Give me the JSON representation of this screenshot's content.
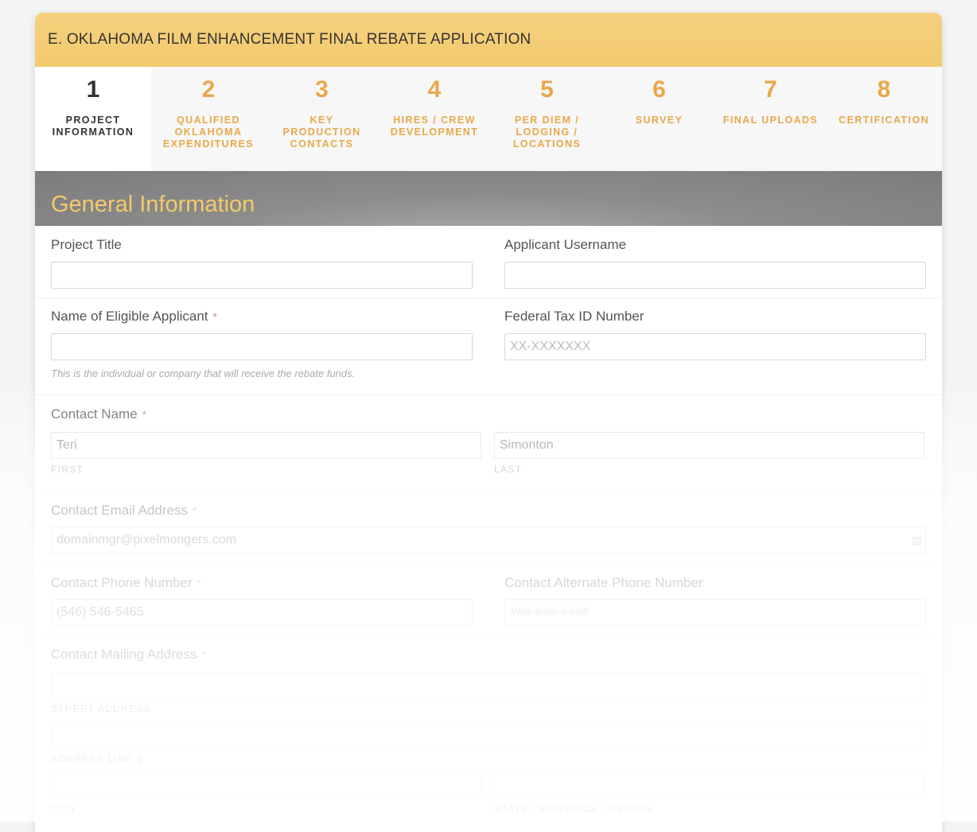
{
  "app": {
    "title": "E. OKLAHOMA FILM ENHANCEMENT FINAL REBATE APPLICATION"
  },
  "steps": [
    {
      "num": "1",
      "label": "PROJECT INFORMATION"
    },
    {
      "num": "2",
      "label": "QUALIFIED OKLAHOMA EXPENDITURES"
    },
    {
      "num": "3",
      "label": "KEY PRODUCTION CONTACTS"
    },
    {
      "num": "4",
      "label": "HIRES / CREW DEVELOPMENT"
    },
    {
      "num": "5",
      "label": "PER DIEM / LODGING / LOCATIONS"
    },
    {
      "num": "6",
      "label": "SURVEY"
    },
    {
      "num": "7",
      "label": "FINAL UPLOADS"
    },
    {
      "num": "8",
      "label": "CERTIFICATION"
    }
  ],
  "section": {
    "title": "General Information"
  },
  "form": {
    "project_title": {
      "label": "Project Title",
      "value": ""
    },
    "applicant_username": {
      "label": "Applicant Username",
      "value": ""
    },
    "eligible_applicant": {
      "label": "Name of Eligible Applicant",
      "required": "*",
      "value": "",
      "help": "This is the individual or company that will receive the rebate funds."
    },
    "federal_tax_id": {
      "label": "Federal Tax ID Number",
      "placeholder": "XX-XXXXXXX",
      "value": ""
    },
    "contact_name": {
      "label": "Contact Name",
      "required": "*",
      "first_value": "Teri",
      "first_sub": "FIRST",
      "last_value": "Simonton",
      "last_sub": "LAST"
    },
    "contact_email": {
      "label": "Contact Email Address",
      "required": "*",
      "value": "domainmgr@pixelmongers.com"
    },
    "contact_phone": {
      "label": "Contact Phone Number",
      "required": "*",
      "value": "(546) 546-5465"
    },
    "alt_phone": {
      "label": "Contact Alternate Phone Number",
      "placeholder": "###-###-####"
    },
    "mailing_address": {
      "label": "Contact Mailing Address",
      "required": "*",
      "street_sub": "STREET ADDRESS",
      "line2_sub": "ADDRESS LINE 2",
      "city_sub": "CITY",
      "state_sub": "STATE / PROVINCE / REGION"
    }
  },
  "colors": {
    "accent": "#f2ca6e",
    "step_text": "#e8a84a",
    "section_band": "#8c8c8c",
    "section_title": "#f5c96a"
  }
}
